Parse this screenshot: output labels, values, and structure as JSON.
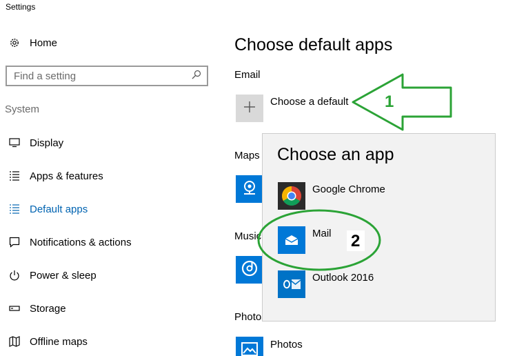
{
  "window": {
    "title": "Settings"
  },
  "sidebar": {
    "home": {
      "label": "Home",
      "icon": "gear-icon"
    },
    "search": {
      "placeholder": "Find a setting",
      "icon": "search-icon"
    },
    "group_label": "System",
    "items": [
      {
        "label": "Display",
        "icon": "display-icon",
        "active": false
      },
      {
        "label": "Apps & features",
        "icon": "apps-list-icon",
        "active": false
      },
      {
        "label": "Default apps",
        "icon": "default-apps-icon",
        "active": true
      },
      {
        "label": "Notifications & actions",
        "icon": "notifications-icon",
        "active": false
      },
      {
        "label": "Power & sleep",
        "icon": "power-icon",
        "active": false
      },
      {
        "label": "Storage",
        "icon": "storage-icon",
        "active": false
      },
      {
        "label": "Offline maps",
        "icon": "offline-maps-icon",
        "active": false
      }
    ],
    "accent_color": "#0063b1"
  },
  "main": {
    "title": "Choose default apps",
    "email": {
      "label": "Email",
      "button_label": "Choose a default",
      "icon": "plus-icon"
    },
    "maps": {
      "label": "Maps",
      "icon": "maps-app-icon"
    },
    "music": {
      "label": "Music",
      "icon": "groove-music-icon"
    },
    "photos": {
      "label": "Photos",
      "app_name": "Photos",
      "icon": "photos-icon"
    },
    "tile_color": "#0078d7"
  },
  "popup": {
    "title": "Choose an app",
    "apps": [
      {
        "name": "Google Chrome",
        "icon": "chrome-icon"
      },
      {
        "name": "Mail",
        "icon": "mail-icon"
      },
      {
        "name": "Outlook 2016",
        "icon": "outlook-icon"
      }
    ]
  },
  "annotations": {
    "arrow": {
      "label": "1",
      "color": "#2ba336"
    },
    "circle": {
      "label": "2",
      "color": "#2ba336"
    }
  }
}
